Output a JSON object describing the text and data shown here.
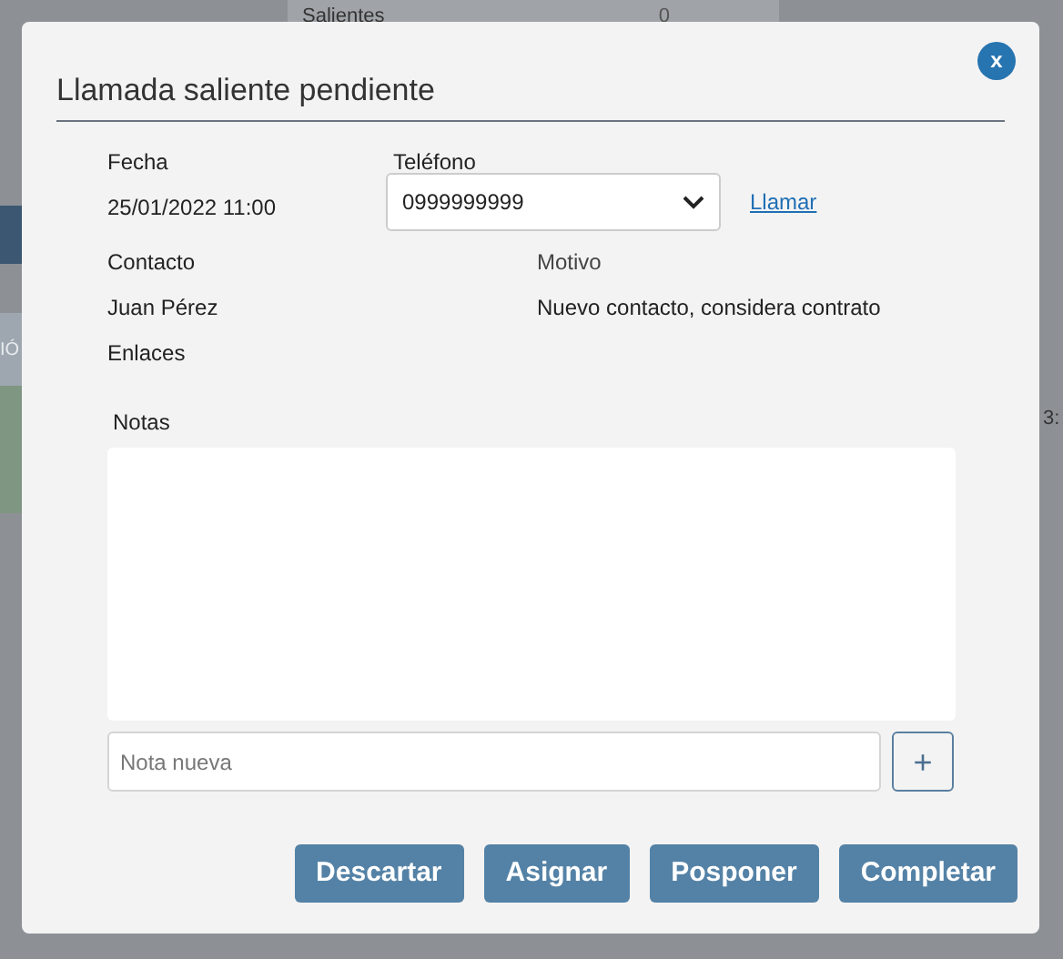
{
  "background": {
    "texts": [
      {
        "text": "Salientes",
        "kind": "label"
      },
      {
        "text": "0",
        "kind": "value"
      }
    ],
    "side_label": "IÓ",
    "edge_text": "3:"
  },
  "dialog": {
    "title": "Llamada saliente pendiente",
    "close": "x",
    "fields": [
      {
        "label": "Fecha",
        "value": "25/01/2022 11:00"
      },
      {
        "label": "Teléfono",
        "value": "0999999999",
        "link": "Llamar"
      }
    ],
    "contact": {
      "label": "Contacto",
      "value": "Juan Pérez",
      "links_label": "Enlaces"
    },
    "reason": {
      "label": "Motivo",
      "value": "Nuevo contacto, considera contrato"
    },
    "notes": {
      "label": "Notas",
      "placeholder": "Nota nueva",
      "add": "+"
    },
    "buttons": [
      "Descartar",
      "Asignar",
      "Posponer",
      "Completar"
    ]
  }
}
